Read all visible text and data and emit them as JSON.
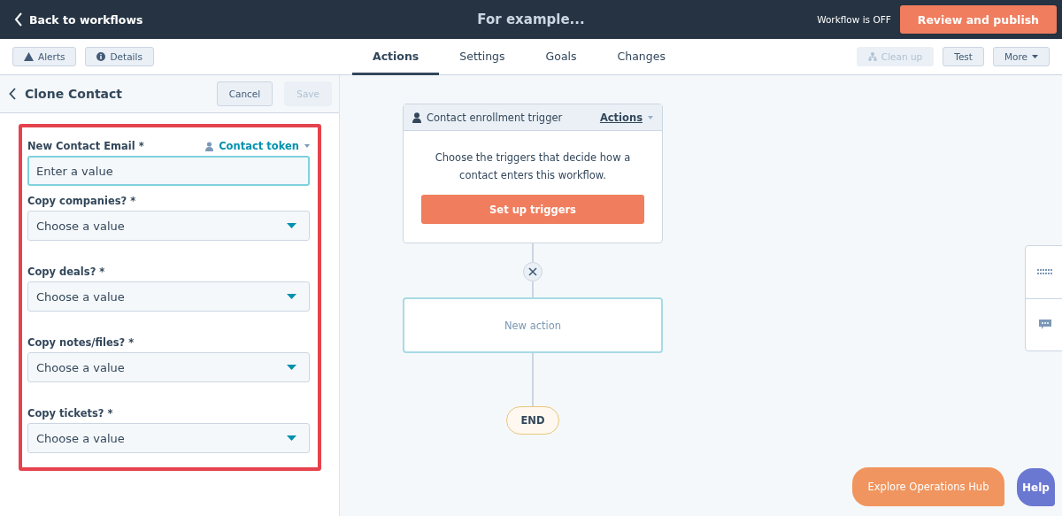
{
  "header": {
    "back": "Back to workflows",
    "title": "For example...",
    "status": "Workflow is OFF",
    "publish": "Review and publish"
  },
  "toolbar": {
    "left_buttons": [
      {
        "label": "Alerts",
        "kind": "alert"
      },
      {
        "label": "Details",
        "kind": "info"
      }
    ],
    "tabs": [
      {
        "label": "Actions",
        "selected": true
      },
      {
        "label": "Settings",
        "selected": false
      },
      {
        "label": "Goals",
        "selected": false
      },
      {
        "label": "Changes",
        "selected": false
      }
    ],
    "right_buttons": [
      {
        "label": "Clean up",
        "kind": "cleanup",
        "disabled": true
      },
      {
        "label": "Test",
        "kind": "plain",
        "disabled": false
      },
      {
        "label": "More",
        "kind": "menu",
        "disabled": false
      }
    ]
  },
  "panel": {
    "title": "Clone Contact",
    "cancel": "Cancel",
    "save": {
      "label": "Save",
      "disabled": true
    },
    "token": "Contact token",
    "fields": [
      {
        "kind": "text",
        "label": "New Contact Email *",
        "placeholder": "Enter a value"
      },
      {
        "kind": "select",
        "label": "Copy companies? *",
        "value": "Choose a value"
      },
      {
        "kind": "select",
        "label": "Copy deals? *",
        "value": "Choose a value"
      },
      {
        "kind": "select",
        "label": "Copy notes/files? *",
        "value": "Choose a value"
      },
      {
        "kind": "select",
        "label": "Copy tickets? *",
        "value": "Choose a value"
      }
    ]
  },
  "canvas": {
    "trigger": {
      "title": "Contact enrollment trigger",
      "actions": "Actions",
      "text": "Choose the triggers that decide how a contact enters this workflow.",
      "button": "Set up triggers"
    },
    "new_action": "New action",
    "end": "END"
  },
  "floating": {
    "explore": "Explore Operations Hub",
    "help": "Help"
  }
}
